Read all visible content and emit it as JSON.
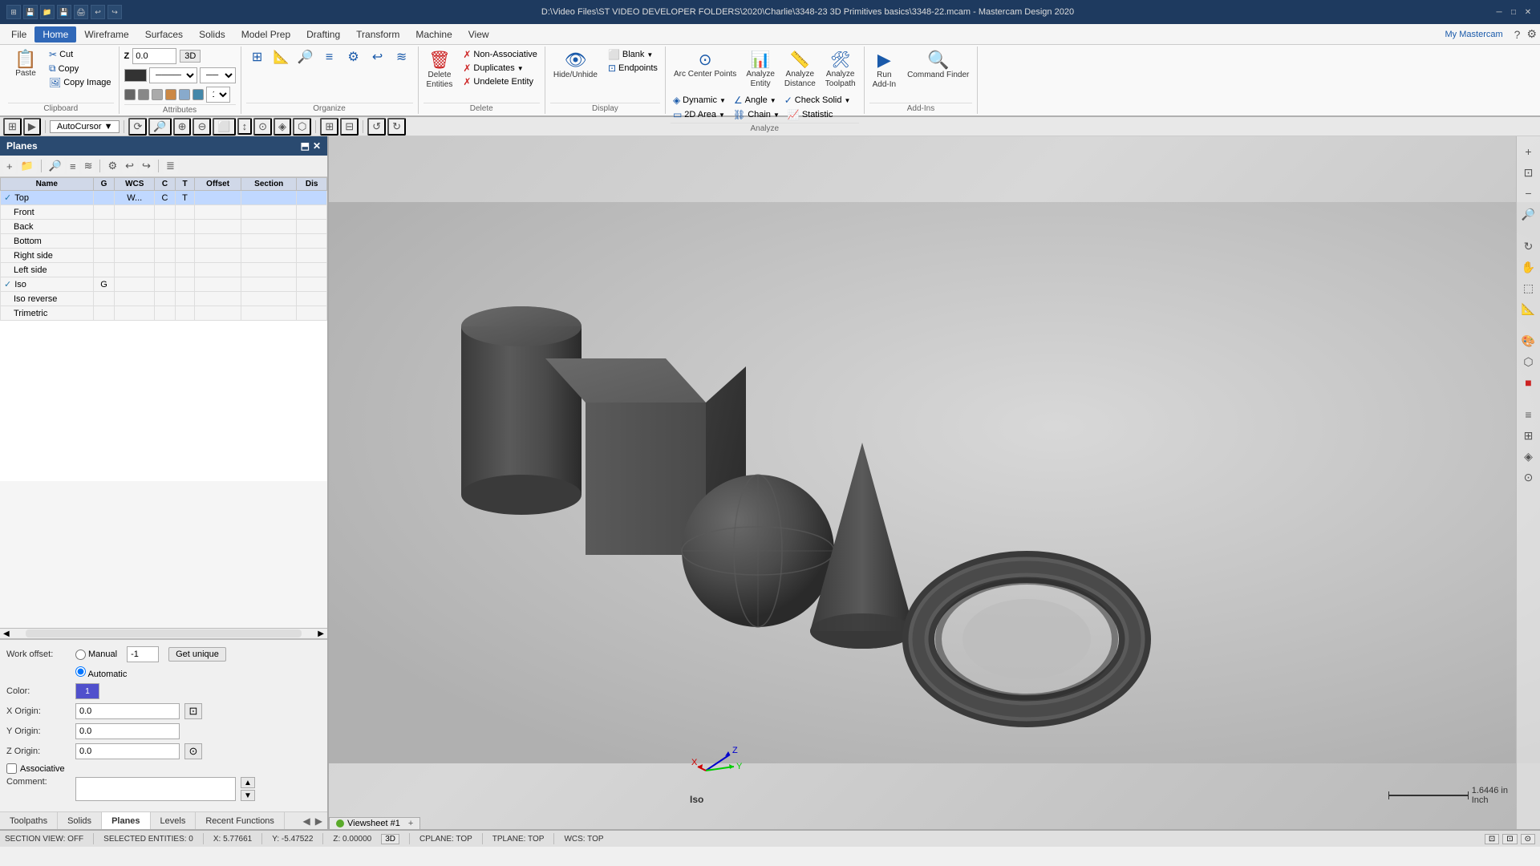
{
  "window": {
    "title": "D:\\Video Files\\ST VIDEO DEVELOPER FOLDERS\\2020\\Charlie\\3348-23 3D Primitives basics\\3348-22.mcam - Mastercam Design 2020",
    "min_btn": "─",
    "max_btn": "□",
    "close_btn": "✕"
  },
  "menu": {
    "items": [
      "File",
      "Home",
      "Wireframe",
      "Surfaces",
      "Solids",
      "Model Prep",
      "Drafting",
      "Transform",
      "Machine",
      "View"
    ]
  },
  "ribbon": {
    "active_tab": "Home",
    "groups": {
      "clipboard": {
        "label": "Clipboard",
        "paste": "Paste",
        "cut": "Cut",
        "copy": "Copy",
        "copy_image": "Copy Image"
      },
      "attributes": {
        "label": "Attributes"
      },
      "organize": {
        "label": "Organize",
        "z_label": "Z",
        "z_value": "0.0",
        "mode_3d": "3D"
      },
      "delete": {
        "label": "Delete",
        "delete_entities": "Delete\nEntities",
        "non_associative": "Non-Associative",
        "duplicates": "Duplicates",
        "undelete_entity": "Undelete Entity"
      },
      "display": {
        "label": "Display",
        "hide_unhide": "Hide/Unhide",
        "blank": "Blank",
        "endpoints": "Endpoints"
      },
      "analyze": {
        "label": "Analyze",
        "arc_center_points": "Arc Center Points",
        "endpoints": "Endpoints",
        "analyze_entity": "Analyze\nEntity",
        "analyze_distance": "Analyze\nDistance",
        "analyze_toolpath": "Analyze\nToolpath",
        "dynamic": "Dynamic",
        "angle": "Angle",
        "2d_area": "2D Area",
        "chain": "Chain",
        "check_solid": "Check Solid",
        "statistic": "Statistic"
      },
      "add_ins": {
        "label": "Add-Ins",
        "run_addin": "Run\nAdd-In",
        "command_finder": "Command\nFinder"
      }
    },
    "my_mastercam": "My Mastercam"
  },
  "sidebar": {
    "title": "Planes",
    "columns": [
      "Name",
      "G",
      "WCS",
      "C",
      "T",
      "Offset",
      "Section",
      "Dis"
    ],
    "planes": [
      {
        "name": "Top",
        "checked": true,
        "wcs": "W...",
        "c": "C",
        "t": "T",
        "g": "",
        "indent": false,
        "selected": true
      },
      {
        "name": "Front",
        "checked": false,
        "wcs": "",
        "c": "",
        "t": "",
        "g": "",
        "indent": true
      },
      {
        "name": "Back",
        "checked": false,
        "wcs": "",
        "c": "",
        "t": "",
        "g": "",
        "indent": true
      },
      {
        "name": "Bottom",
        "checked": false,
        "wcs": "",
        "c": "",
        "t": "",
        "g": "",
        "indent": true
      },
      {
        "name": "Right side",
        "checked": false,
        "wcs": "",
        "c": "",
        "t": "",
        "g": "",
        "indent": true
      },
      {
        "name": "Left side",
        "checked": false,
        "wcs": "",
        "c": "",
        "t": "",
        "g": "",
        "indent": true
      },
      {
        "name": "Iso",
        "checked": true,
        "wcs": "",
        "c": "",
        "t": "",
        "g": "G",
        "indent": false,
        "selected": false
      },
      {
        "name": "Iso reverse",
        "checked": false,
        "wcs": "",
        "c": "",
        "t": "",
        "g": "",
        "indent": true
      },
      {
        "name": "Trimetric",
        "checked": false,
        "wcs": "",
        "c": "",
        "t": "",
        "g": "",
        "indent": true
      }
    ],
    "work_offset": {
      "label": "Work offset:",
      "manual": "Manual",
      "automatic": "Automatic",
      "value": "-1",
      "get_unique": "Get unique"
    },
    "color": {
      "label": "Color:",
      "value": "1"
    },
    "x_origin": {
      "label": "X Origin:",
      "value": "0.0"
    },
    "y_origin": {
      "label": "Y Origin:",
      "value": "0.0"
    },
    "z_origin": {
      "label": "Z Origin:",
      "value": "0.0"
    },
    "associative": "Associative",
    "comment": "Comment:"
  },
  "bottom_tabs": {
    "tabs": [
      "Toolpaths",
      "Solids",
      "Planes",
      "Levels",
      "Recent Functions"
    ],
    "active": "Planes"
  },
  "viewport": {
    "view_label": "Iso",
    "scale_value": "1.6446 in",
    "scale_unit": "Inch"
  },
  "status_bar": {
    "section_view": "SECTION VIEW: OFF",
    "selected_entities": "SELECTED ENTITIES: 0",
    "x_coord": "X: 5.77661",
    "y_coord": "Y: -5.47522",
    "z_coord": "Z: 0.00000",
    "mode": "3D",
    "cplane": "CPLANE: TOP",
    "tplane": "TPLANE: TOP",
    "wcs": "WCS: TOP"
  },
  "viewsheet": {
    "label": "Viewsheet #1"
  }
}
